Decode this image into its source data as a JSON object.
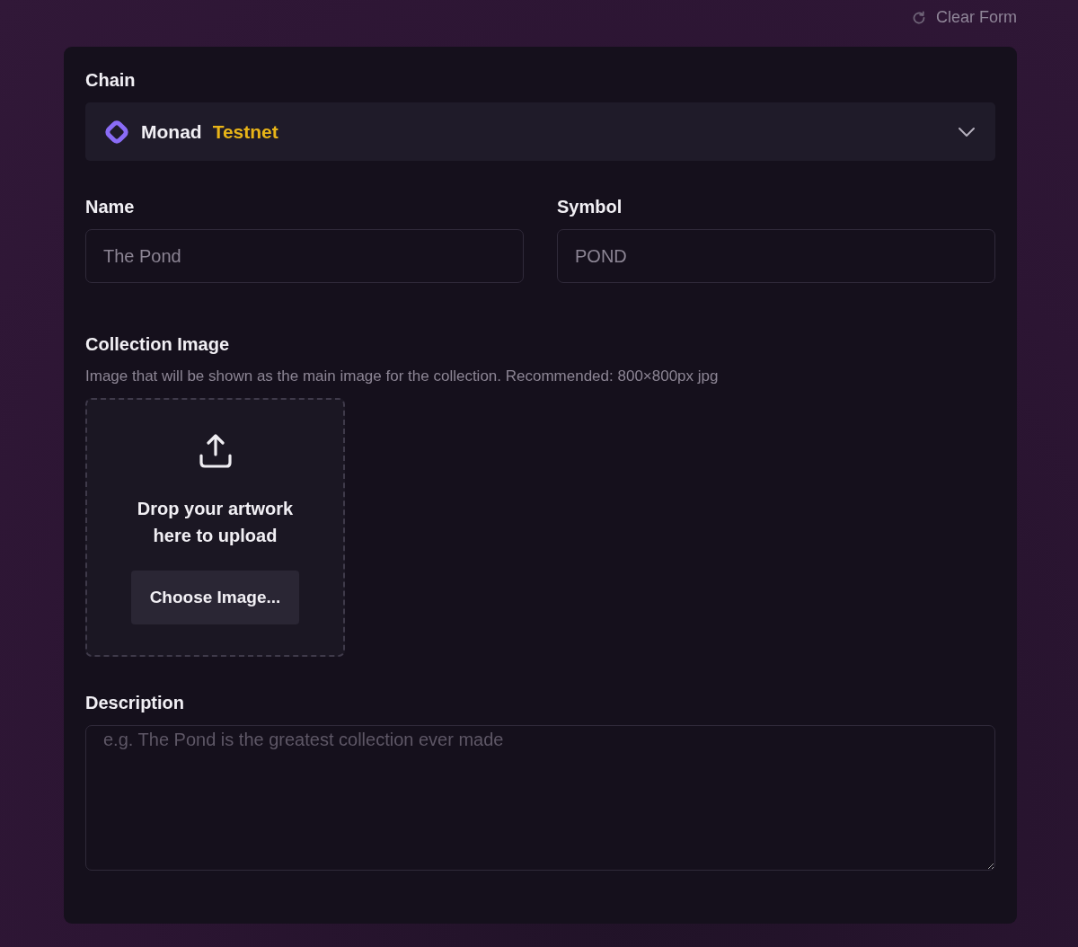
{
  "clear_form": {
    "label": "Clear Form"
  },
  "chain": {
    "label": "Chain",
    "name": "Monad",
    "network": "Testnet"
  },
  "name": {
    "label": "Name",
    "placeholder": "The Pond"
  },
  "symbol": {
    "label": "Symbol",
    "placeholder": "POND"
  },
  "collection_image": {
    "label": "Collection Image",
    "hint": "Image that will be shown as the main image for the collection. Recommended: 800×800px jpg",
    "drop_text": "Drop your artwork here to upload",
    "button": "Choose Image..."
  },
  "description": {
    "label": "Description",
    "placeholder": "e.g. The Pond is the greatest collection ever made"
  }
}
